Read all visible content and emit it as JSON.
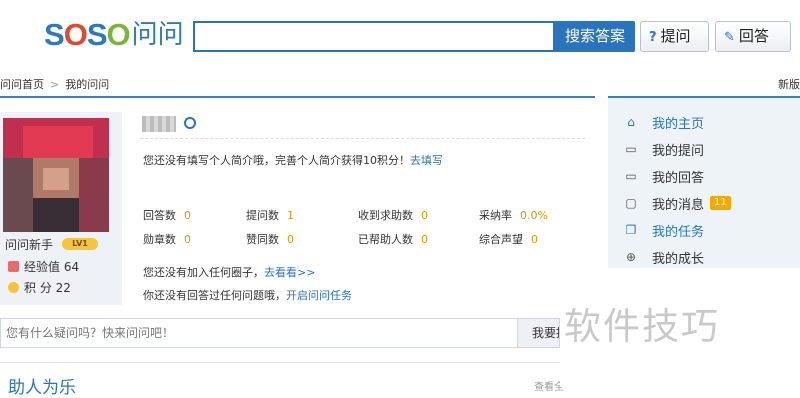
{
  "header": {
    "logo_letters": [
      "S",
      "O",
      "S",
      "O"
    ],
    "logo_cn": "问问",
    "search": {
      "value": "",
      "button_label": "搜索答案"
    },
    "ask_label": "提问",
    "reply_label": "回答"
  },
  "breadcrumb": {
    "home": "问问首页",
    "separator": ">",
    "current": "我的问问"
  },
  "new_version": "新版",
  "profile": {
    "username": "问问新手",
    "level_badge": "LV1",
    "exp_label": "经验值",
    "exp_value": "64",
    "points_label": "积  分",
    "points_value": "22",
    "intro_text": "您还没有填写个人简介哦，完善个人简介获得10积分！",
    "intro_link": "去填写"
  },
  "stats": [
    {
      "label": "回答数",
      "value": "0"
    },
    {
      "label": "提问数",
      "value": "1"
    },
    {
      "label": "收到求助数",
      "value": "0"
    },
    {
      "label": "采纳率",
      "value": "0.0%"
    },
    {
      "label": "勋章数",
      "value": "0"
    },
    {
      "label": "赞同数",
      "value": "0"
    },
    {
      "label": "已帮助人数",
      "value": "0"
    },
    {
      "label": "综合声望",
      "value": "0"
    }
  ],
  "hints": {
    "circle_text": "您还没有加入任何圈子，",
    "circle_link": "去看看>>",
    "task_text": "你还没有回答过任何问题哦，",
    "task_link": "开启问问任务"
  },
  "question_bar": {
    "placeholder": "您有什么疑问吗？快来问问吧！",
    "button_label": "我要提问"
  },
  "help_section": {
    "title": "助人为乐",
    "more": "查看全"
  },
  "sidebar": {
    "items": [
      {
        "label": "我的主页",
        "icon": "home-icon"
      },
      {
        "label": "我的提问",
        "icon": "speech-bubble-icon"
      },
      {
        "label": "我的回答",
        "icon": "answer-bubble-icon"
      },
      {
        "label": "我的消息",
        "icon": "message-icon",
        "badge": "11"
      },
      {
        "label": "我的任务",
        "icon": "task-icon"
      },
      {
        "label": "我的成长",
        "icon": "growth-icon"
      }
    ]
  },
  "watermark": "软件技巧",
  "colors": {
    "brand_blue": "#2a74bb",
    "badge_orange": "#f2a900"
  }
}
